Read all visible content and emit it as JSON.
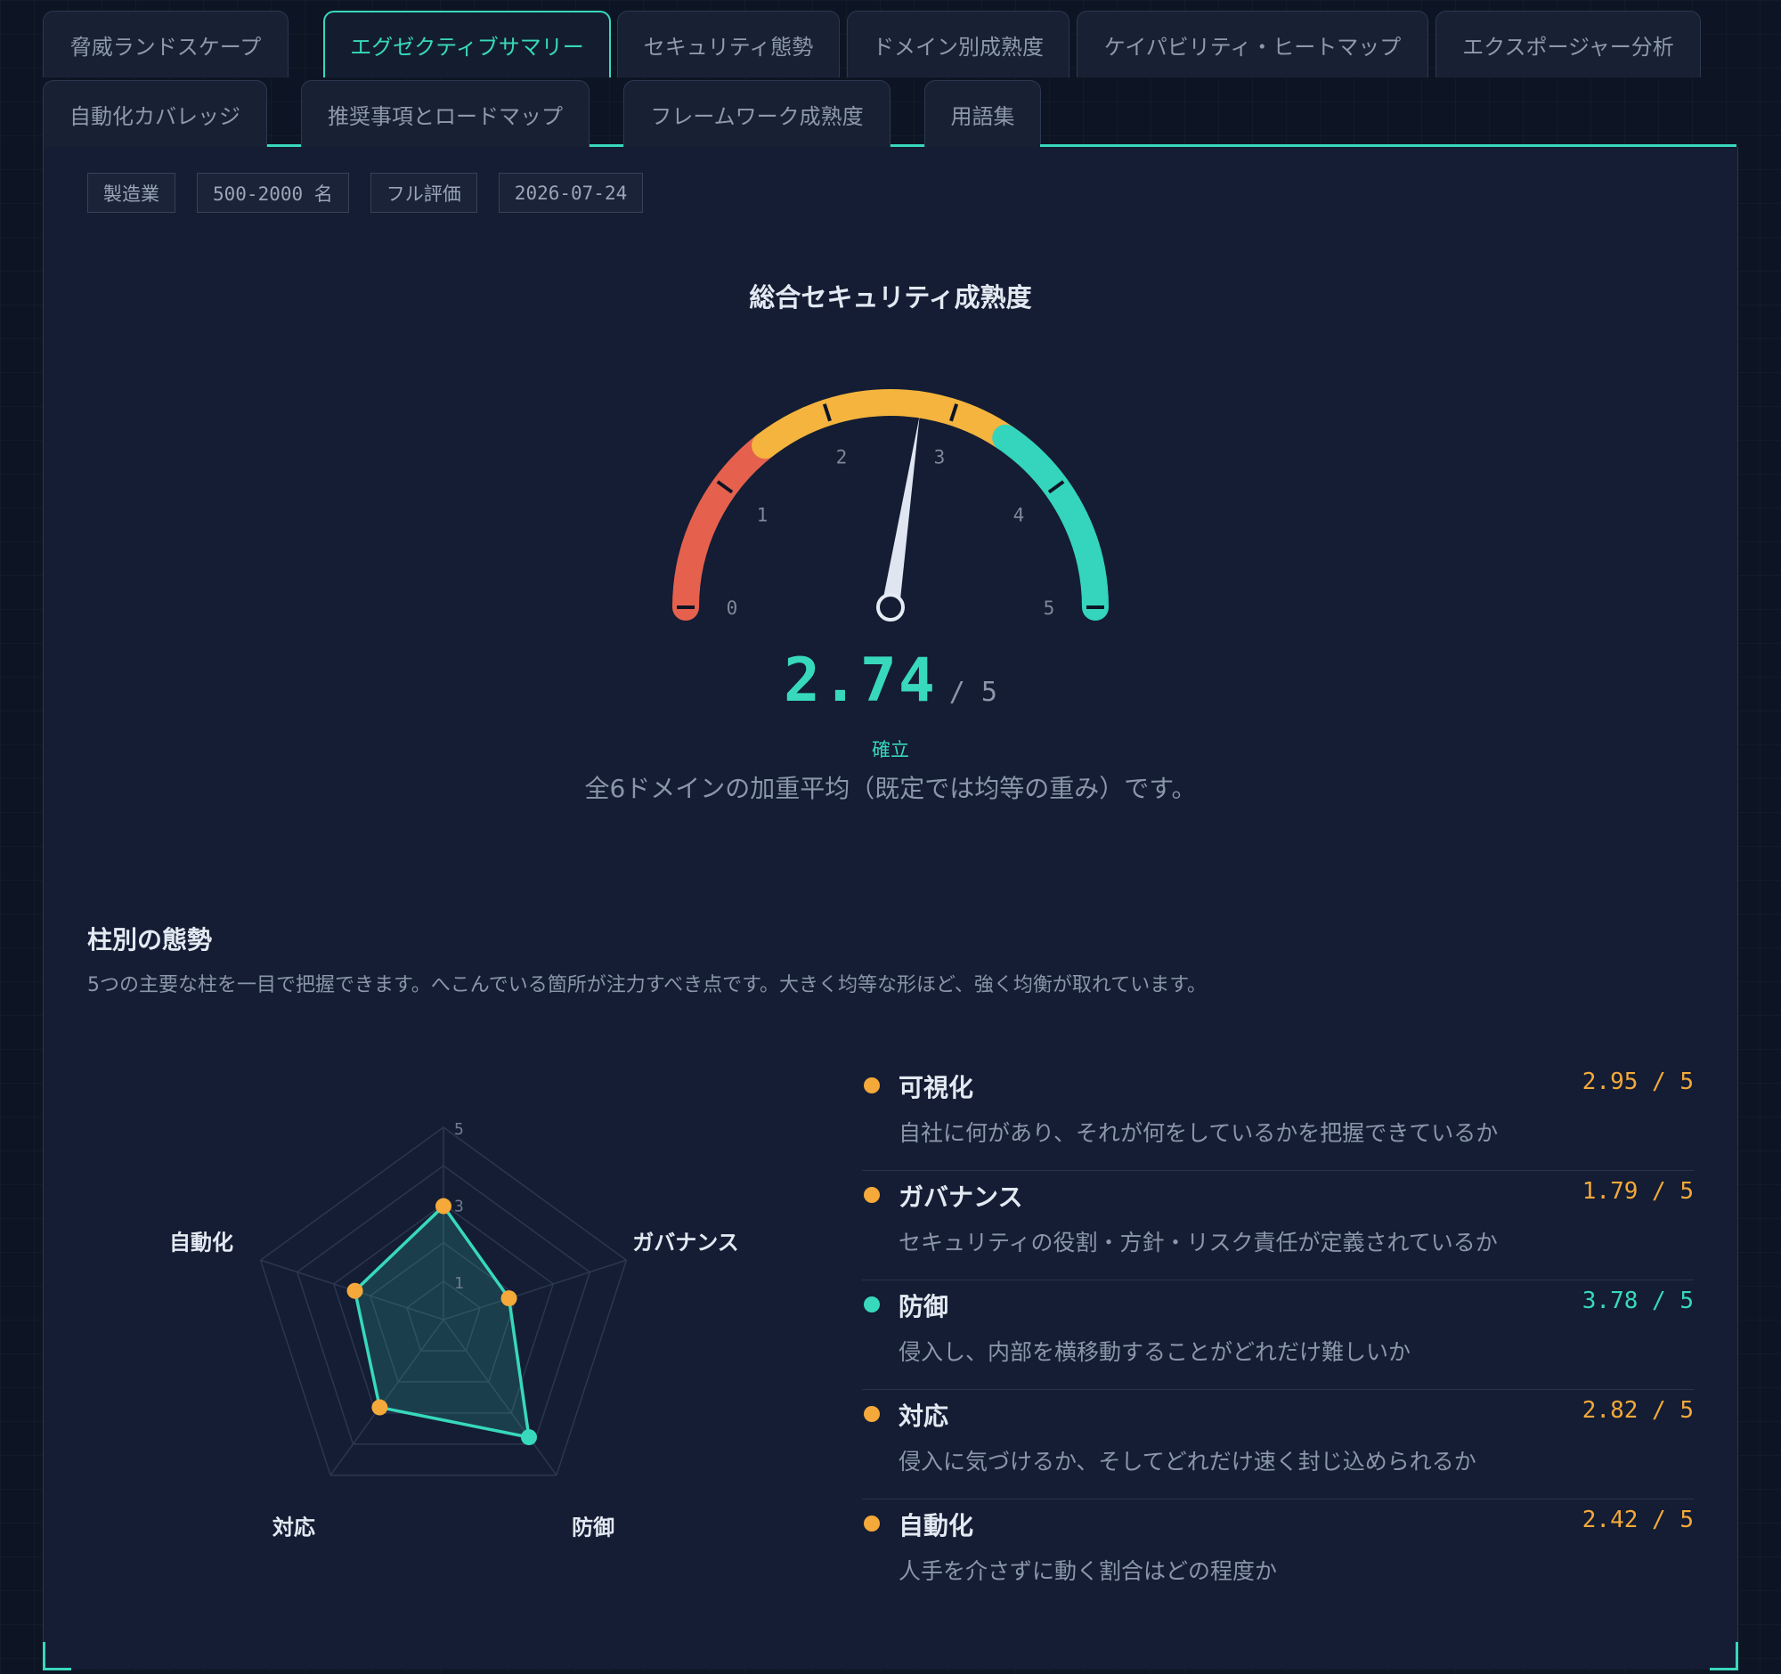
{
  "tabs": {
    "row1": [
      {
        "label": "脅威ランドスケープ",
        "active": false
      },
      {
        "label": "エグゼクティブサマリー",
        "active": true
      },
      {
        "label": "セキュリティ態勢",
        "active": false
      },
      {
        "label": "ドメイン別成熟度",
        "active": false
      },
      {
        "label": "ケイパビリティ・ヒートマップ",
        "active": false
      },
      {
        "label": "エクスポージャー分析",
        "active": false
      }
    ],
    "row2": [
      {
        "label": "自動化カバレッジ",
        "active": false
      },
      {
        "label": "推奨事項とロードマップ",
        "active": false
      },
      {
        "label": "フレームワーク成熟度",
        "active": false
      },
      {
        "label": "用語集",
        "active": false
      }
    ]
  },
  "chips": [
    "製造業",
    "500-2000 名",
    "フル評価",
    "2026-07-24"
  ],
  "gauge": {
    "title": "総合セキュリティ成熟度",
    "value": 2.74,
    "max": 5,
    "value_label": "2.74",
    "max_label": "/ 5",
    "level": "確立",
    "description": "全6ドメインの加重平均（既定では均等の重み）です。",
    "ticks": [
      "0",
      "1",
      "2",
      "3",
      "4",
      "5"
    ],
    "bands": [
      {
        "from": 0,
        "to": 1.45,
        "color": "#e5614e"
      },
      {
        "from": 1.45,
        "to": 3.45,
        "color": "#f4b43d"
      },
      {
        "from": 3.45,
        "to": 5,
        "color": "#34d4bd"
      }
    ]
  },
  "pillars_section": {
    "title": "柱別の態勢",
    "description": "5つの主要な柱を一目で把握できます。へこんでいる箇所が注力すべき点です。大きく均等な形ほど、強く均衡が取れています。",
    "scale_labels": [
      "5",
      "3",
      "1"
    ]
  },
  "chart_data": {
    "type": "radar",
    "categories": [
      "可視化",
      "ガバナンス",
      "防御",
      "対応",
      "自動化"
    ],
    "values": [
      2.95,
      1.79,
      3.78,
      2.82,
      2.42
    ],
    "rmax": 5,
    "rings": [
      1,
      2,
      3,
      4,
      5
    ],
    "point_colors": [
      "#f4a93a",
      "#f4a93a",
      "#38d8bd",
      "#f4a93a",
      "#f4a93a"
    ]
  },
  "pillars": [
    {
      "name": "可視化",
      "score": "2.95 / 5",
      "color": "#f4a93a",
      "desc": "自社に何があり、それが何をしているかを把握できているか"
    },
    {
      "name": "ガバナンス",
      "score": "1.79 / 5",
      "color": "#f4a93a",
      "desc": "セキュリティの役割・方針・リスク責任が定義されているか"
    },
    {
      "name": "防御",
      "score": "3.78 / 5",
      "color": "#38d8bd",
      "desc": "侵入し、内部を横移動することがどれだけ難しいか"
    },
    {
      "name": "対応",
      "score": "2.82 / 5",
      "color": "#f4a93a",
      "desc": "侵入に気づけるか、そしてどれだけ速く封じ込められるか"
    },
    {
      "name": "自動化",
      "score": "2.42 / 5",
      "color": "#f4a93a",
      "desc": "人手を介さずに動く割合はどの程度か"
    }
  ]
}
